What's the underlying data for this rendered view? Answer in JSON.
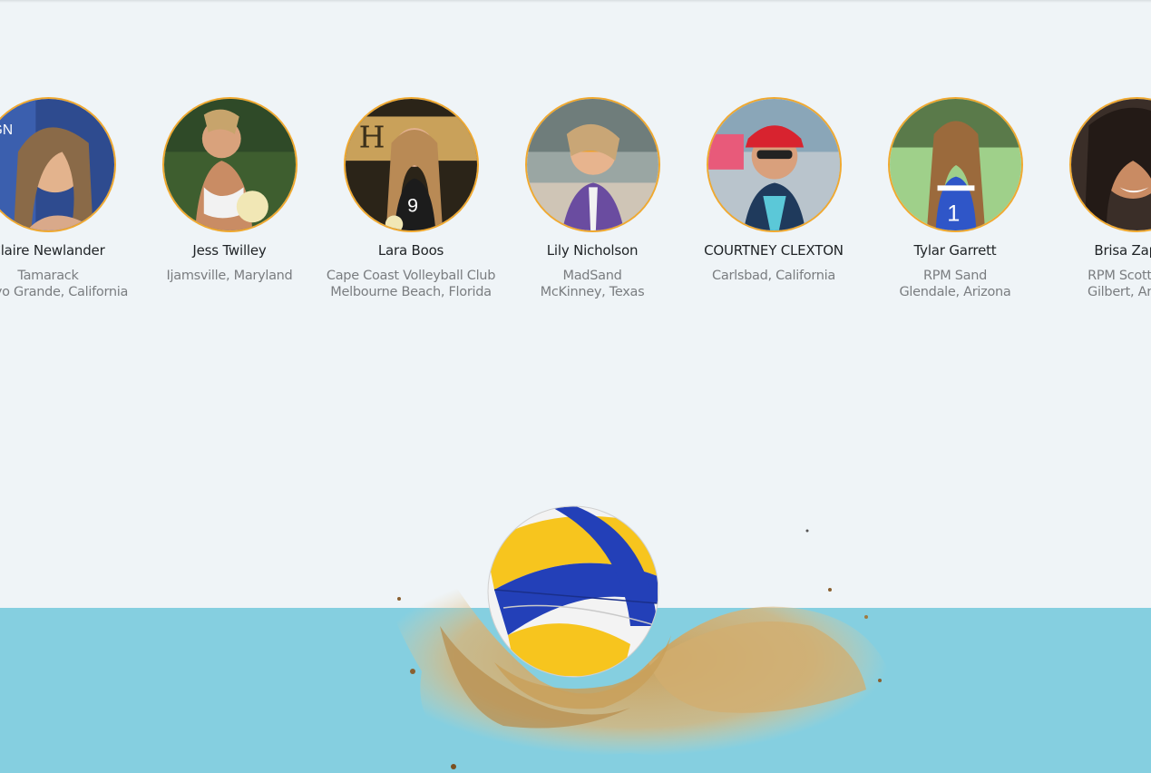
{
  "players": [
    {
      "name": "Claire Newlander",
      "club": "Tamarack",
      "location": "Arroyo Grande, California"
    },
    {
      "name": "Jess Twilley",
      "club": "",
      "location": "Ijamsville, Maryland"
    },
    {
      "name": "Lara Boos",
      "club": "Cape Coast Volleyball Club",
      "location": "Melbourne Beach, Florida"
    },
    {
      "name": "Lily Nicholson",
      "club": "MadSand",
      "location": "McKinney, Texas"
    },
    {
      "name": "COURTNEY CLEXTON",
      "club": "",
      "location": "Carlsbad, California"
    },
    {
      "name": "Tylar Garrett",
      "club": "RPM Sand",
      "location": "Glendale, Arizona"
    },
    {
      "name": "Brisa Zapata",
      "club": "RPM Scottsdale",
      "location": "Gilbert, Arizona"
    }
  ],
  "colors": {
    "page_background": "#eff4f7",
    "avatar_border": "#f0a930",
    "sand_band": "#85cfe0",
    "ball_blue": "#2340b8",
    "ball_yellow": "#f7c51e"
  },
  "icons": [
    "volleyball-illustration",
    "player-photo"
  ]
}
